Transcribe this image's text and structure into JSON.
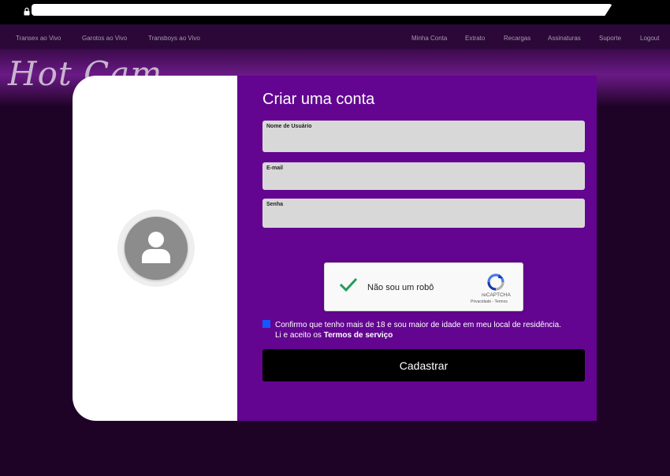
{
  "nav": {
    "left": [
      "Transex ao Vivo",
      "Garotos ao Vivo",
      "Transboys ao Vivo"
    ],
    "right": [
      "Minha Conta",
      "Extrato",
      "Recargas",
      "Assinaturas",
      "Suporte",
      "Logout"
    ]
  },
  "banner": {
    "logo_text": "Hot Cam"
  },
  "form": {
    "title": "Criar uma conta",
    "username_label": "Nome de Usuário",
    "username_value": "",
    "email_label": "E-mail",
    "email_value": "",
    "password_label": "Senha",
    "password_value": "",
    "captcha": {
      "label": "Não sou um robô",
      "brand": "reCAPTCHA",
      "links": "Privacidade - Termos",
      "checked": true
    },
    "age_confirm_text": "Confirmo que tenho mais de 18 e sou maior de idade em meu local de residência. Li e aceito os ",
    "terms_link": "Termos de serviço",
    "age_confirm_checked": true,
    "submit_label": "Cadastrar"
  },
  "icons": {
    "lock": "lock-icon",
    "avatar": "user-avatar-icon",
    "captcha_check": "checkmark-icon",
    "recaptcha": "recaptcha-icon"
  },
  "colors": {
    "page_bg": "#1e0326",
    "panel_purple": "#630590",
    "checkbox_blue": "#1657ff",
    "captcha_green": "#1e9e5c"
  }
}
